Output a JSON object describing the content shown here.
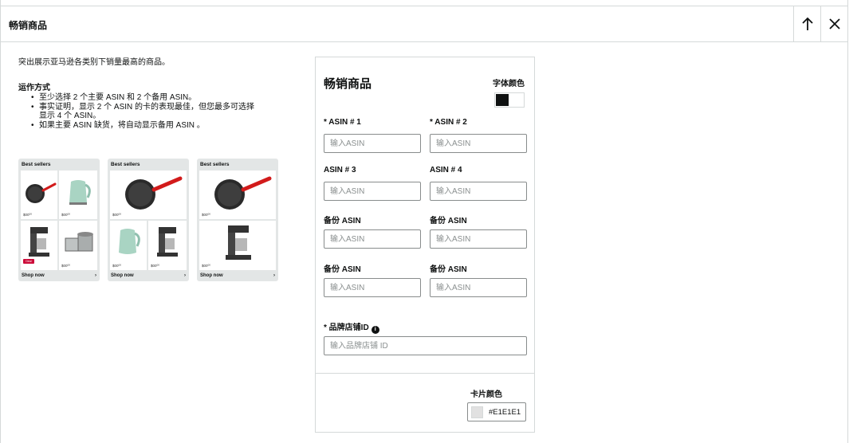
{
  "header": {
    "title": "畅销商品"
  },
  "left": {
    "intro": "突出展示亚马逊各类别下销量最高的商品。",
    "how_title": "运作方式",
    "how_items": [
      "至少选择 2 个主要 ASIN 和 2 个备用 ASIN。",
      "事实证明，显示 2 个 ASIN 的卡的表现最佳，但您最多可选择显示 4 个 ASIN。",
      "如果主要 ASIN 缺货，将自动显示备用 ASIN 。"
    ]
  },
  "previews": [
    {
      "title": "Best sellers",
      "footer": "Shop now",
      "prices": [
        "$00⁰⁰",
        "$00⁰⁰",
        "$00⁰⁰"
      ],
      "deal": "Deal"
    },
    {
      "title": "Best sellers",
      "footer": "Shop now",
      "prices": [
        "$00⁰⁰",
        "$00⁰⁰",
        "$00⁰⁰"
      ]
    },
    {
      "title": "Best sellers",
      "footer": "Shop now",
      "prices": [
        "$00⁰⁰",
        "$00⁰⁰"
      ]
    }
  ],
  "form": {
    "title": "畅销商品",
    "font_color_label": "字体颜色",
    "fields": [
      {
        "label": "* ASIN # 1",
        "placeholder": "输入ASIN"
      },
      {
        "label": "* ASIN # 2",
        "placeholder": "输入ASIN"
      },
      {
        "label": "ASIN # 3",
        "placeholder": "输入ASIN"
      },
      {
        "label": "ASIN # 4",
        "placeholder": "输入ASIN"
      },
      {
        "label": "备份 ASIN",
        "placeholder": "输入ASIN"
      },
      {
        "label": "备份 ASIN",
        "placeholder": "输入ASIN"
      },
      {
        "label": "备份 ASIN",
        "placeholder": "输入ASIN"
      },
      {
        "label": "备份 ASIN",
        "placeholder": "输入ASIN"
      }
    ],
    "store_id": {
      "label": "* 品牌店铺ID",
      "placeholder": "输入品牌店铺 ID"
    },
    "card_color_label": "卡片颜色",
    "card_color_value": "#E1E1E1"
  },
  "colors": {
    "card_bg": "#e3e6e6",
    "font_black": "#0f1111",
    "card_color": "#E1E1E1",
    "deal_red": "#cc0c39",
    "pan_red": "#d21b1b",
    "kettle_green": "#a9d4c3"
  }
}
